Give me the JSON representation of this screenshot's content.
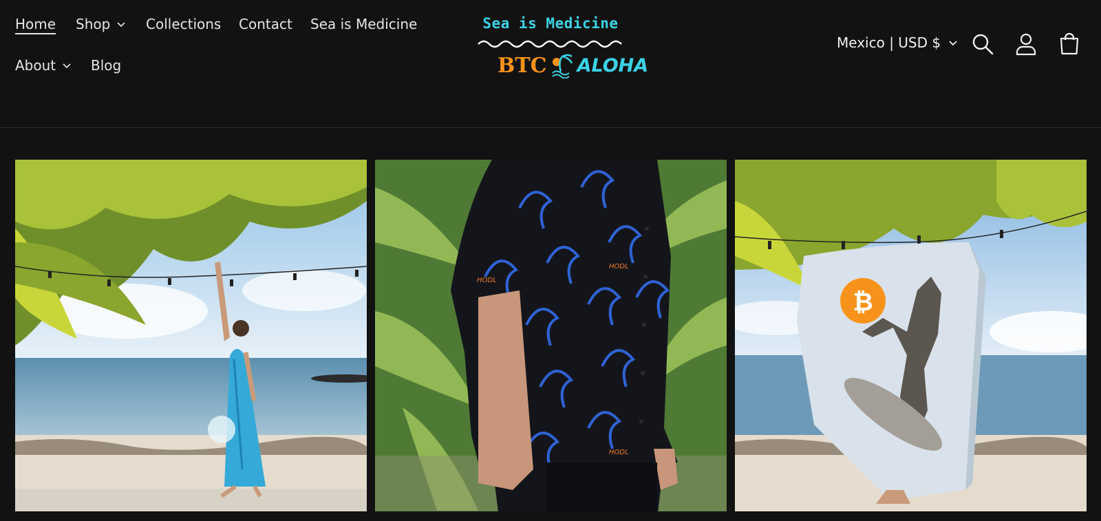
{
  "nav": {
    "home": "Home",
    "shop": "Shop",
    "collections": "Collections",
    "contact": "Contact",
    "sea_is_medicine": "Sea is Medicine",
    "about": "About",
    "blog": "Blog"
  },
  "logo": {
    "top_text": "Sea is Medicine",
    "btc_text": "BTC",
    "aloha_text": "ALOHA",
    "shirt_print": "HODL"
  },
  "locale": {
    "label": "Mexico | USD $"
  },
  "colors": {
    "background": "#121212",
    "logo_cyan": "#3ad3e6",
    "bitcoin_orange": "#f7931a"
  },
  "icons": [
    "chevron-down-icon",
    "search-icon",
    "account-icon",
    "cart-icon"
  ]
}
